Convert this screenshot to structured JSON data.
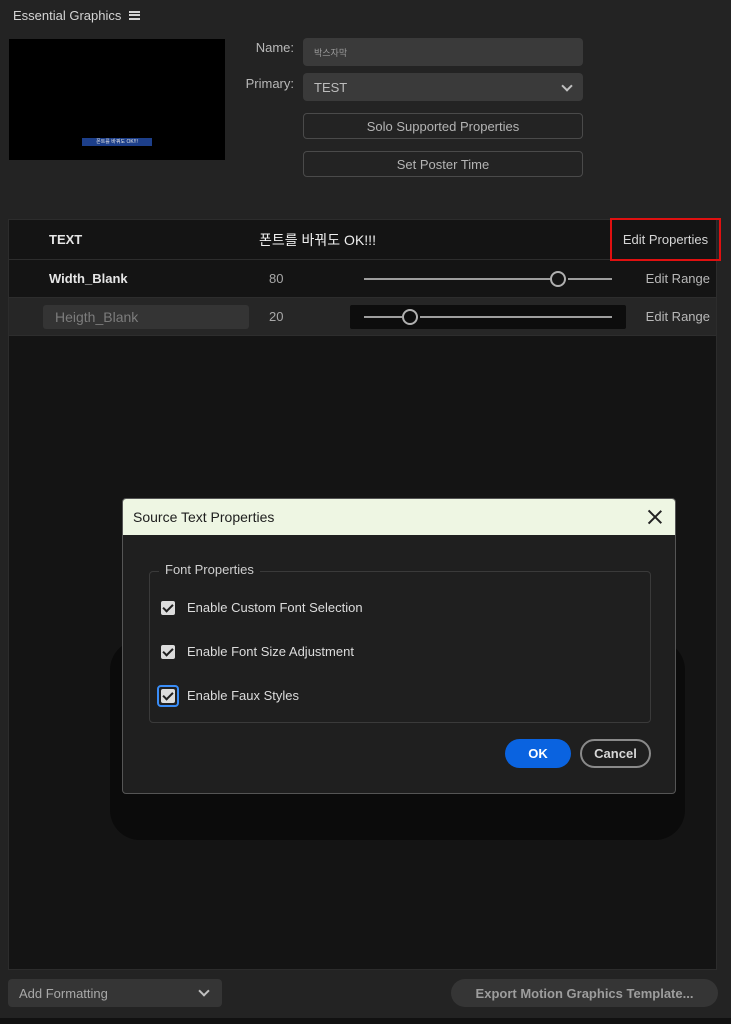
{
  "panel": {
    "title": "Essential Graphics",
    "menu_icon": "hamburger-menu-icon"
  },
  "preview": {
    "caption": "폰트를 바꿔도 OK!!!"
  },
  "fields": {
    "name_label": "Name:",
    "name_value": "박스자막",
    "primary_label": "Primary:",
    "primary_value": "TEST"
  },
  "buttons": {
    "solo_supported": "Solo Supported Properties",
    "set_poster_time": "Set Poster Time"
  },
  "properties": [
    {
      "name": "TEXT",
      "value": "폰트를 바꿔도 OK!!!",
      "action": "Edit Properties"
    },
    {
      "name": "Width_Blank",
      "value": "80",
      "action": "Edit Range",
      "slider_level": 0.8
    },
    {
      "name": "Heigth_Blank",
      "value": "20",
      "action": "Edit Range",
      "slider_level": 0.2
    }
  ],
  "dialog": {
    "title": "Source Text Properties",
    "group_label": "Font Properties",
    "options": [
      {
        "label": "Enable Custom Font Selection",
        "checked": true
      },
      {
        "label": "Enable Font Size Adjustment",
        "checked": true
      },
      {
        "label": "Enable Faux Styles",
        "checked": true,
        "focused": true
      }
    ],
    "ok_label": "OK",
    "cancel_label": "Cancel"
  },
  "bottom": {
    "add_formatting": "Add Formatting",
    "export": "Export Motion Graphics Template..."
  },
  "colors": {
    "highlight": "#e01010",
    "primary_button": "#0a63e0",
    "dialog_titlebar": "#eef6e3",
    "focus_ring": "#3a8df7"
  }
}
